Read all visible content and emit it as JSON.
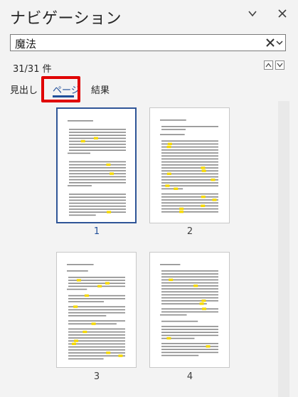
{
  "pane": {
    "title": "ナビゲーション",
    "options_icon": "chevron-down-icon",
    "close_icon": "close-icon"
  },
  "search": {
    "value": "魔法",
    "clear_icon": "clear-icon",
    "dropdown_icon": "chevron-down-icon"
  },
  "results": {
    "count": "31/31 件",
    "prev_icon": "triangle-up-icon",
    "next_icon": "triangle-down-icon"
  },
  "tabs": [
    {
      "label": "見出し",
      "active": false
    },
    {
      "label": "ページ",
      "active": true
    },
    {
      "label": "結果",
      "active": false
    }
  ],
  "pages": [
    {
      "number": "1",
      "selected": true
    },
    {
      "number": "2",
      "selected": false
    },
    {
      "number": "3",
      "selected": false
    },
    {
      "number": "4",
      "selected": false
    }
  ],
  "colors": {
    "accent": "#1f4e99",
    "highlight_box": "#e00000",
    "search_hit": "#f5d800"
  }
}
